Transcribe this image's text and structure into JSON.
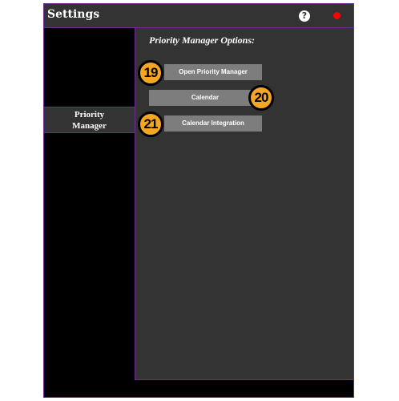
{
  "window": {
    "title": "Settings",
    "help_glyph": "?",
    "icons": {
      "help": "help-icon",
      "close": "close-icon"
    },
    "colors": {
      "border": "#6b2f8f",
      "panel": "#333333",
      "close": "#ff0000",
      "badge": "#f5a623",
      "button": "#7d7d7d"
    }
  },
  "sidebar": {
    "items": [
      {
        "label_line1": "Priority",
        "label_line2": "Manager",
        "selected": true
      }
    ]
  },
  "main": {
    "heading": "Priority Manager Options:",
    "buttons": [
      {
        "label": "Open Priority Manager",
        "badge": "19"
      },
      {
        "label": "Calendar",
        "badge": "20"
      },
      {
        "label": "Calendar Integration",
        "badge": "21"
      }
    ]
  }
}
